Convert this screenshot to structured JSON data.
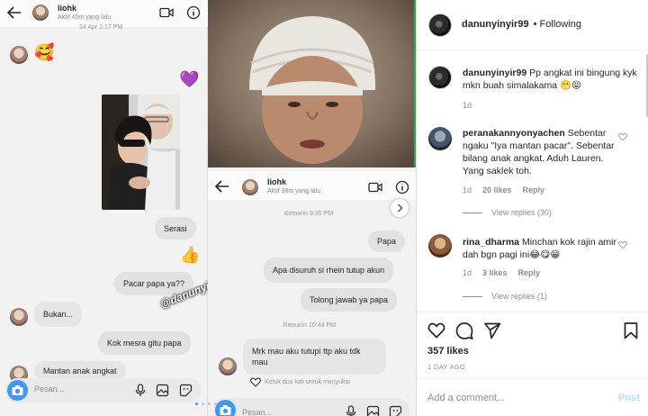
{
  "shot1": {
    "contact_name": "liohk",
    "status": "Aktif 45m yang lalu",
    "date_stamp": "24 Apr 1:17 PM",
    "messages_in": [
      "Bukan...",
      "Mantan anak angkat"
    ],
    "messages_out": [
      "Serasi",
      "Pacar papa ya??",
      "Kok mesra gitu papa"
    ],
    "compose_placeholder": "Pesan...",
    "watermark": "@danunyinyir99",
    "emojis": {
      "face": "🥰",
      "heart": "💜",
      "thumbs": "👍"
    }
  },
  "shot2": {
    "contact_name": "liohk",
    "status": "Aktif 38m yang lalu",
    "time_1": "Kemarin 9:35 PM",
    "time_2": "Kemarin 10:44 PM",
    "messages_out": [
      "Papa",
      "Apa disuruh si rhein tutup akun",
      "Tolong jawab ya papa"
    ],
    "message_in": "Mrk mau aku tutupi ttp aku tdk mau",
    "tap_hint": "Ketuk dua kali untuk menyukai",
    "compose_placeholder": "Pesan..."
  },
  "panel": {
    "author": "danunyinyir99",
    "following": "• Following",
    "caption": {
      "user": "danunyinyir99",
      "text": "Pp angkat ini bingung kyk mkn buah simalakama 😬😝",
      "age": "1d"
    },
    "comments": [
      {
        "user": "peranakannyonyachen",
        "text": "Sebentar ngaku \"Iya mantan pacar\". Sebentar bilang anak angkat. Aduh Lauren. Yang saklek toh.",
        "age": "1d",
        "likes": "20 likes",
        "reply": "Reply",
        "view_replies": "View replies (30)"
      },
      {
        "user": "rina_dharma",
        "text": "Minchan kok rajin amir dah bgn pagi ini😂😋😁",
        "age": "1d",
        "likes": "3 likes",
        "reply": "Reply",
        "view_replies": "View replies (1)"
      }
    ],
    "likes": "357 likes",
    "date": "1 DAY AGO",
    "add_comment_placeholder": "Add a comment...",
    "post_label": "Post"
  },
  "colors": {
    "accent_blue": "#3f97f6",
    "post_disabled": "#b2dffc",
    "muted": "#8e8e8e"
  },
  "icons": [
    "back-arrow-icon",
    "video-call-icon",
    "info-icon",
    "camera-icon",
    "mic-icon",
    "gallery-icon",
    "sticker-icon",
    "heart-icon",
    "comment-icon",
    "share-icon",
    "bookmark-icon"
  ]
}
